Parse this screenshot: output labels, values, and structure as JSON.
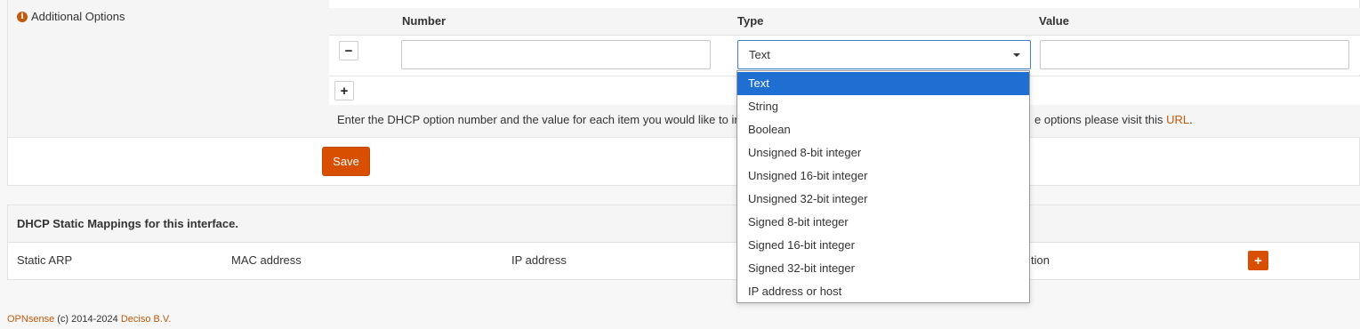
{
  "options_section": {
    "label": "Additional Options",
    "columns": {
      "number": "Number",
      "type": "Type",
      "value": "Value"
    },
    "row": {
      "number_value": "",
      "type_value": "Text",
      "value_value": ""
    },
    "remove_glyph": "−",
    "add_glyph": "+",
    "help_prefix": "Enter the DHCP option number and the value for each item you would like to in",
    "help_suffix": "e options please visit this ",
    "help_link": "URL",
    "help_end": "."
  },
  "type_dropdown": {
    "options": [
      "Text",
      "String",
      "Boolean",
      "Unsigned 8-bit integer",
      "Unsigned 16-bit integer",
      "Unsigned 32-bit integer",
      "Signed 8-bit integer",
      "Signed 16-bit integer",
      "Signed 32-bit integer",
      "IP address or host"
    ],
    "selected_index": 0
  },
  "save_label": "Save",
  "static_mappings": {
    "title": "DHCP Static Mappings for this interface.",
    "columns": [
      "Static ARP",
      "MAC address",
      "IP address",
      "tion"
    ],
    "add_glyph": "+"
  },
  "footer": {
    "brand": "OPNsense",
    "copyright": " (c) 2014-2024 ",
    "company": "Deciso B.V."
  },
  "colors": {
    "accent": "#d94f00",
    "link": "#c2590c",
    "selection": "#1f6fd2",
    "focus_border": "#3a7fd0"
  },
  "icons": {
    "info": "info-icon",
    "caret": "caret-down-icon"
  }
}
